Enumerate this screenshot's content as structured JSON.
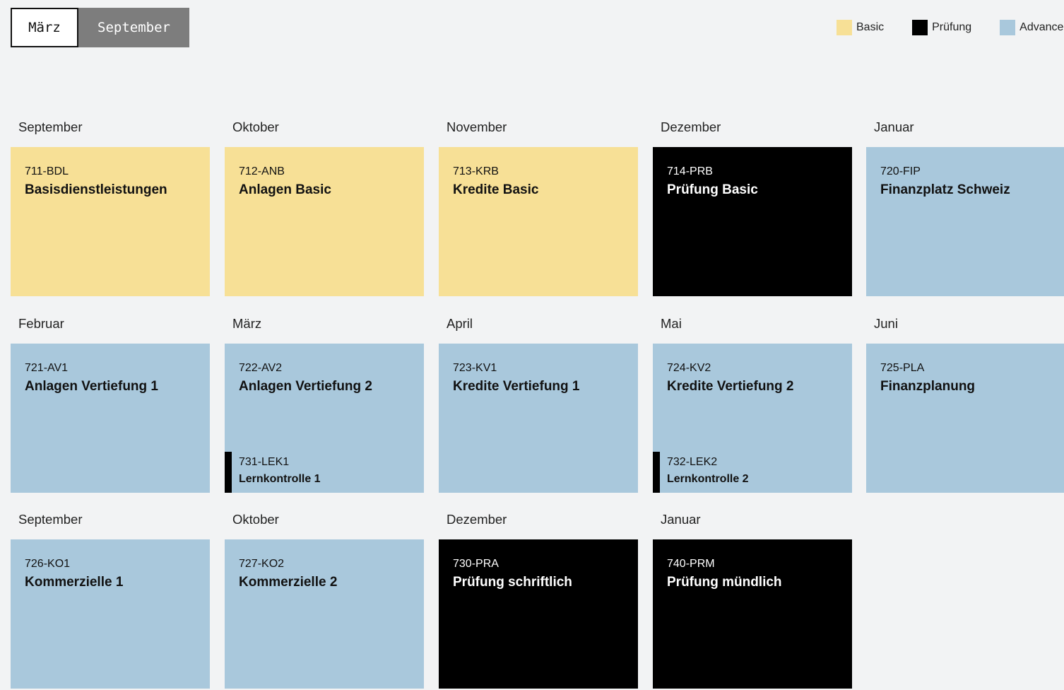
{
  "toggle": {
    "active_label": "März",
    "inactive_label": "September"
  },
  "legend": [
    {
      "label": "Basic",
      "color": "#f7e096"
    },
    {
      "label": "Prüfung",
      "color": "#000000"
    },
    {
      "label": "Advanced",
      "color": "#a9c8dc"
    }
  ],
  "rows": [
    [
      {
        "month": "September",
        "code": "711-BDL",
        "title": "Basisdienstleistungen",
        "type": "basic"
      },
      {
        "month": "Oktober",
        "code": "712-ANB",
        "title": "Anlagen Basic",
        "type": "basic"
      },
      {
        "month": "November",
        "code": "713-KRB",
        "title": "Kredite Basic",
        "type": "basic"
      },
      {
        "month": "Dezember",
        "code": "714-PRB",
        "title": "Prüfung Basic",
        "type": "pruefung"
      },
      {
        "month": "Januar",
        "code": "720-FIP",
        "title": "Finanzplatz Schweiz",
        "type": "advanced"
      }
    ],
    [
      {
        "month": "Februar",
        "code": "721-AV1",
        "title": "Anlagen Vertiefung 1",
        "type": "advanced"
      },
      {
        "month": "März",
        "code": "722-AV2",
        "title": "Anlagen Vertiefung 2",
        "type": "advanced",
        "sub": {
          "code": "731-LEK1",
          "title": "Lernkontrolle 1"
        }
      },
      {
        "month": "April",
        "code": "723-KV1",
        "title": "Kredite Vertiefung 1",
        "type": "advanced"
      },
      {
        "month": "Mai",
        "code": "724-KV2",
        "title": "Kredite Vertiefung 2",
        "type": "advanced",
        "sub": {
          "code": "732-LEK2",
          "title": "Lernkontrolle 2"
        }
      },
      {
        "month": "Juni",
        "code": "725-PLA",
        "title": "Finanzplanung",
        "type": "advanced"
      }
    ],
    [
      {
        "month": "September",
        "code": "726-KO1",
        "title": "Kommerzielle 1",
        "type": "advanced"
      },
      {
        "month": "Oktober",
        "code": "727-KO2",
        "title": "Kommerzielle 2",
        "type": "advanced"
      },
      {
        "month": "Dezember",
        "code": "730-PRA",
        "title": "Prüfung schriftlich",
        "type": "pruefung"
      },
      {
        "month": "Januar",
        "code": "740-PRM",
        "title": "Prüfung mündlich",
        "type": "pruefung"
      }
    ]
  ]
}
